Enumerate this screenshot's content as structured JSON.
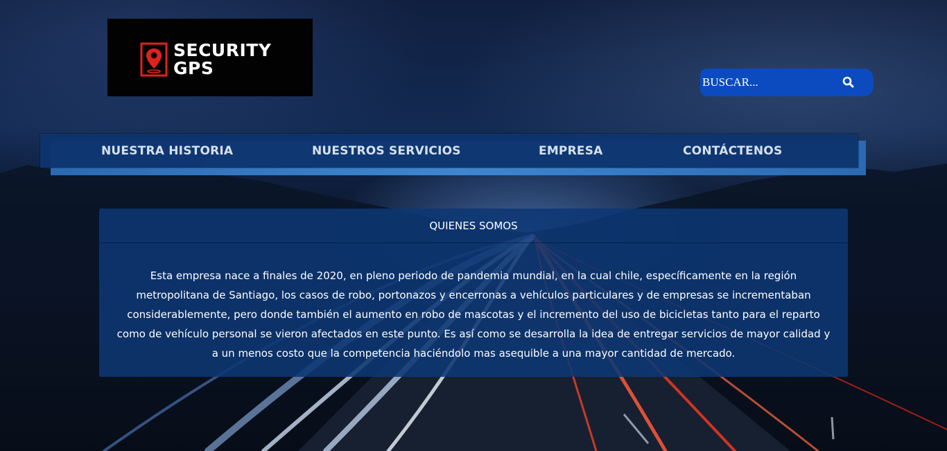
{
  "brand": {
    "logo_line1": "SECURITY",
    "logo_line2": "GPS",
    "logo_icon": "location-pin-icon",
    "accent_color": "#e0221c"
  },
  "search": {
    "placeholder": "BUSCAR...",
    "value": "",
    "button_icon": "search-icon",
    "bg_color": "#0b4bbf"
  },
  "nav": {
    "items": [
      {
        "label": "NUESTRA HISTORIA"
      },
      {
        "label": "NUESTROS SERVICIOS"
      },
      {
        "label": "EMPRESA"
      },
      {
        "label": "CONTÁCTENOS"
      }
    ],
    "bg_color": "#0e346e"
  },
  "about": {
    "title": "QUIENES SOMOS",
    "body": "Esta empresa nace a finales de 2020, en pleno periodo de pandemia mundial, en la cual chile, específicamente en la región metropolitana de Santiago, los casos de robo, portonazos y encerronas a vehículos particulares y de empresas se incrementaban considerablemente, pero donde también el aumento en robo de mascotas y el incremento del uso de bicicletas tanto para el reparto como de vehículo personal se vieron afectados en este punto. Es así como se desarrolla la idea de entregar servicios de mayor calidad y a un menos costo que la competencia haciéndolo mas asequible a una mayor cantidad de mercado."
  }
}
